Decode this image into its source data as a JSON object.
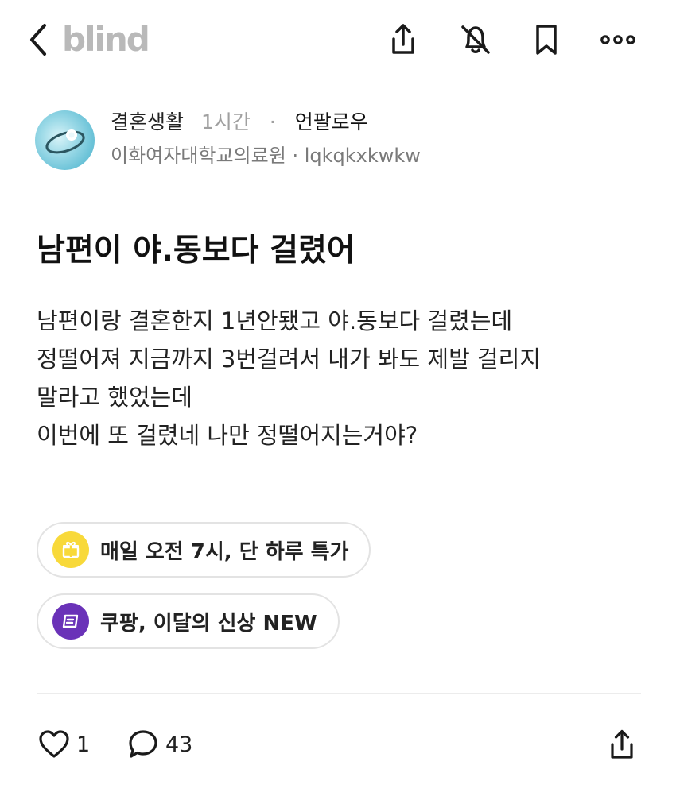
{
  "app": {
    "logo_text": "blind",
    "icons": [
      "back-chevron-icon",
      "share-icon",
      "bell-off-icon",
      "bookmark-icon",
      "more-icon"
    ]
  },
  "post": {
    "board": "결혼생활",
    "time": "1시간",
    "separator": "·",
    "follow_label": "언팔로우",
    "company": "이화여자대학교의료원",
    "username": "lqkqkxkwkw",
    "author_meta_sep": " · ",
    "title": "남편이 야.동보다 걸렸어",
    "body_lines": [
      "남편이랑 결혼한지 1년안됐고 야.동보다 걸렸는데",
      "정떨어져 지금까지 3번걸려서 내가 봐도 제발 걸리지",
      "말라고 했었는데",
      "이번에 또 걸렸네 나만 정떨어지는거야?"
    ]
  },
  "promos": [
    {
      "text": "매일 오전 7시, 단 하루 특가",
      "icon": "gift-icon",
      "color": "#F8D93A"
    },
    {
      "text": "쿠팡, 이달의 신상 NEW",
      "icon": "coupon-icon",
      "color": "#6A32B8"
    }
  ],
  "footer": {
    "likes": "1",
    "comments": "43",
    "icons": [
      "heart-icon",
      "comment-icon",
      "share-icon"
    ]
  },
  "colors": {
    "logo": "#B9B9B9",
    "muted_text": "#A0A0A0",
    "gift_badge": "#F8D93A",
    "coupon_badge": "#6A32B8"
  }
}
